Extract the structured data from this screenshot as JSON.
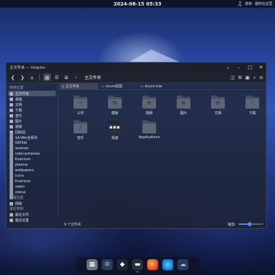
{
  "top_panel": {
    "clock": "2024-08-15 05:33",
    "music_icon": "music-note-icon",
    "media_text": "游侠 · 图你在这里"
  },
  "window": {
    "title": "主文件夹 — Dolphin",
    "controls": [
      "expand-icon",
      "minimize-icon",
      "maximize-icon",
      "close-icon"
    ],
    "toolbar": {
      "breadcrumb": "主文件夹",
      "buttons": [
        "back-icon",
        "forward-icon",
        "home-icon",
        "icon-view-icon",
        "compact-view-icon",
        "details-view-icon"
      ],
      "right_buttons": [
        "split-icon",
        "copy-icon",
        "preview-icon",
        "search-icon",
        "menu-icon"
      ]
    },
    "tabs": [
      {
        "label": "主文件夹",
        "icon": "home-icon"
      },
      {
        "label": "Azure配图",
        "icon": "folder-icon"
      },
      {
        "label": "Azure-kde",
        "icon": "folder-icon"
      }
    ],
    "sidebar": {
      "sections": [
        {
          "heading": "常用位置",
          "items": [
            "主文件夹",
            "桌面",
            "文档",
            "下载",
            "音乐",
            "图片",
            "视频",
            "回收站",
            "1A-Win全系列",
            "GitHub",
            "aurorae",
            "color-schemes",
            "Kvantum",
            "plasma",
            "wallpapers",
            "icons",
            "Kvantum",
            "sddm",
            "status"
          ]
        },
        {
          "heading": "远程位置",
          "items": [
            "网络"
          ]
        },
        {
          "heading": "最近使用",
          "items": [
            "最近文件",
            "最近位置"
          ]
        }
      ]
    },
    "files": [
      {
        "label": "公共",
        "emblem": "share-emblem",
        "style": "normal"
      },
      {
        "label": "模板",
        "emblem": "template-emblem",
        "style": "normal"
      },
      {
        "label": "视频",
        "emblem": "video-emblem",
        "style": "normal"
      },
      {
        "label": "图片",
        "emblem": "image-emblem",
        "style": "normal"
      },
      {
        "label": "文档",
        "emblem": "document-emblem",
        "style": "normal"
      },
      {
        "label": "下载",
        "emblem": "download-emblem",
        "style": "normal"
      },
      {
        "label": "音乐",
        "emblem": "music-emblem",
        "style": "normal"
      },
      {
        "label": "桌面",
        "emblem": "desktop-emblem",
        "style": "dark"
      },
      {
        "label": "Applications",
        "emblem": "",
        "style": "normal"
      }
    ],
    "status": {
      "count": "9 个文件夹",
      "zoom_label": "缩放:",
      "zoom_level": 0.45
    }
  },
  "dock": {
    "apps": [
      "files-icon",
      "settings-icon",
      "store-icon",
      "dolphin-icon",
      "firefox-icon",
      "edge-icon",
      "weather-icon"
    ]
  }
}
